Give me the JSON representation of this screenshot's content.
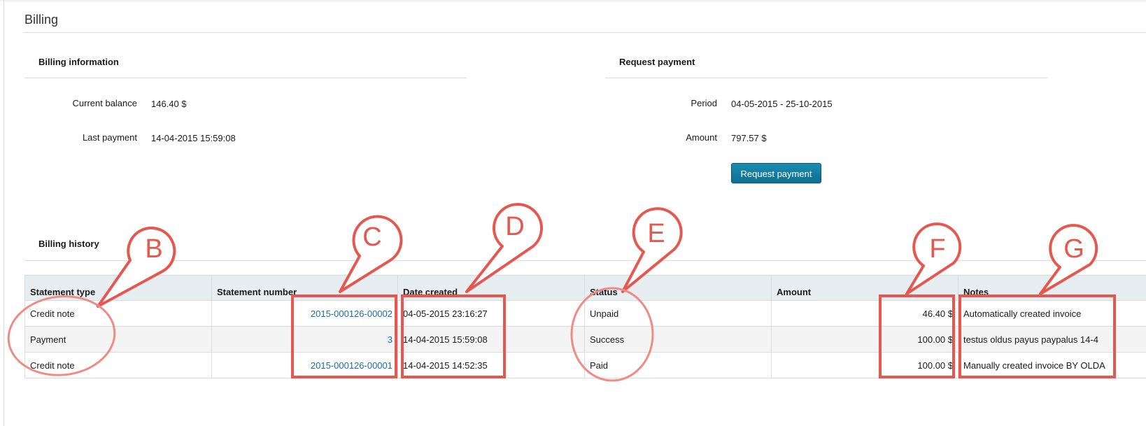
{
  "page": {
    "title": "Billing"
  },
  "billing_info": {
    "heading": "Billing information",
    "current_balance_label": "Current balance",
    "current_balance_value": "146.40 $",
    "last_payment_label": "Last payment",
    "last_payment_value": "14-04-2015 15:59:08"
  },
  "request_payment": {
    "heading": "Request payment",
    "period_label": "Period",
    "period_value": "04-05-2015 - 25-10-2015",
    "amount_label": "Amount",
    "amount_value": "797.57 $",
    "button_label": "Request payment"
  },
  "billing_history": {
    "heading": "Billing history",
    "columns": [
      "Statement type",
      "Statement number",
      "Date created",
      "Status",
      "Amount",
      "Notes"
    ],
    "rows": [
      {
        "type": "Credit note",
        "number": "2015-000126-00002",
        "date": "04-05-2015 23:16:27",
        "status": "Unpaid",
        "amount": "46.40 $",
        "notes": "Automatically created invoice"
      },
      {
        "type": "Payment",
        "number": "3",
        "date": "14-04-2015 15:59:08",
        "status": "Success",
        "amount": "100.00 $",
        "notes": "testus oldus payus paypalus 14-4"
      },
      {
        "type": "Credit note",
        "number": "2015-000126-00001",
        "date": "14-04-2015 14:52:35",
        "status": "Paid",
        "amount": "100.00 $",
        "notes": "Manually created invoice BY OLDA"
      }
    ]
  },
  "annotations": {
    "labels": [
      "B",
      "C",
      "D",
      "E",
      "F",
      "G"
    ],
    "color": "#e5574f"
  },
  "colors": {
    "button": "#127ea3",
    "link": "#1a6ea8",
    "table_header_bg": "#e6eef2"
  }
}
